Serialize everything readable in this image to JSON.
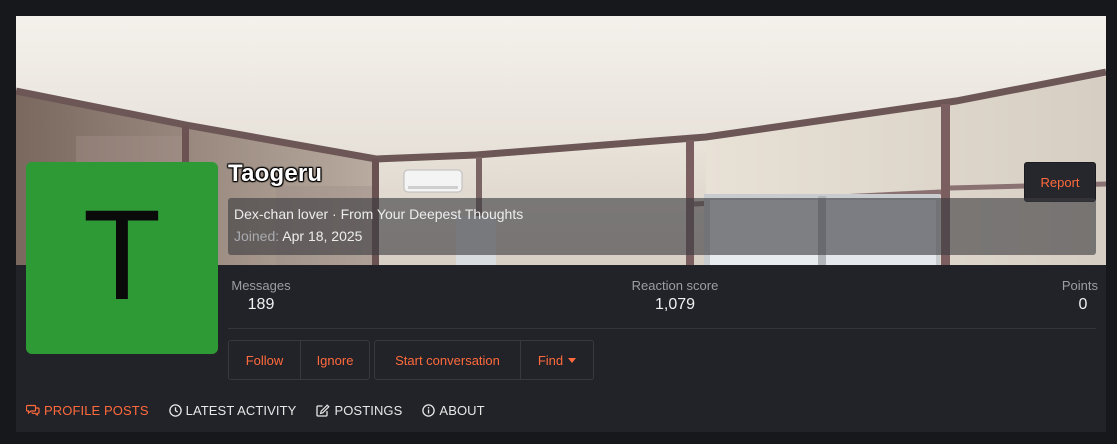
{
  "profile": {
    "avatar_letter": "T",
    "avatar_color": "#2e9a35",
    "username": "Taogeru",
    "blurb": "Dex-chan lover · From Your Deepest Thoughts",
    "joined_label": "Joined:",
    "joined_date": "Apr 18, 2025",
    "report_label": "Report"
  },
  "stats": {
    "messages_label": "Messages",
    "messages_value": "189",
    "reaction_label": "Reaction score",
    "reaction_value": "1,079",
    "points_label": "Points",
    "points_value": "0"
  },
  "actions": {
    "follow": "Follow",
    "ignore": "Ignore",
    "start_conversation": "Start conversation",
    "find": "Find"
  },
  "tabs": [
    {
      "label": "PROFILE POSTS",
      "icon": "comments-icon",
      "active": true
    },
    {
      "label": "LATEST ACTIVITY",
      "icon": "clock-icon",
      "active": false
    },
    {
      "label": "POSTINGS",
      "icon": "edit-icon",
      "active": false
    },
    {
      "label": "ABOUT",
      "icon": "info-icon",
      "active": false
    }
  ],
  "colors": {
    "accent": "#ff6a3d",
    "background": "#222328",
    "page_background": "#17181c"
  }
}
